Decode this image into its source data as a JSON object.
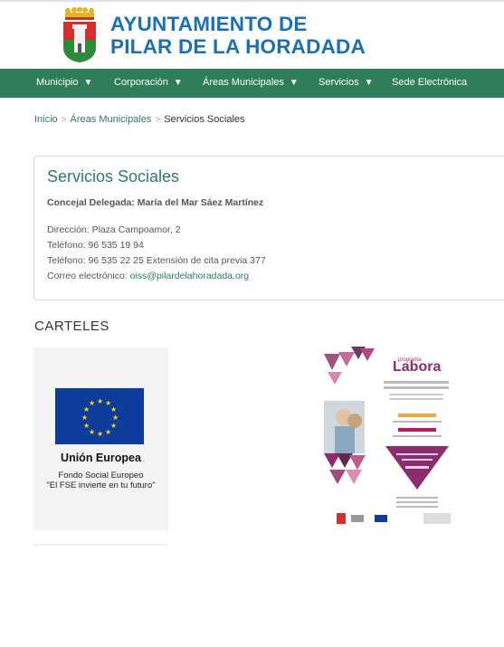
{
  "header": {
    "title_line1": "AYUNTAMIENTO DE",
    "title_line2": "PILAR DE LA HORADADA",
    "crest_icon": "municipal-crest-icon"
  },
  "nav": {
    "items": [
      {
        "label": "Municipio",
        "has_dropdown": true
      },
      {
        "label": "Corporación",
        "has_dropdown": true
      },
      {
        "label": "Áreas Municipales",
        "has_dropdown": true
      },
      {
        "label": "Servicios",
        "has_dropdown": true
      },
      {
        "label": "Sede Electrónica",
        "has_dropdown": false
      }
    ],
    "dropdown_glyph": "▼"
  },
  "breadcrumb": {
    "home": "Inicio",
    "parent": "Áreas Municipales",
    "current": "Servicios Sociales",
    "separator": ">"
  },
  "card": {
    "title": "Servicios Sociales",
    "councillor": "Concejal Delegada: María del Mar Sáez Martínez",
    "address": "Dirección: Plaza Campoamor, 2",
    "phone1": "Teléfono: 96 535 19 94",
    "phone2": "Teléfono: 96 535 22 25 Extensión de cita previa 377",
    "email_label": "Correo electrónico: ",
    "email": "oiss@pilardelahoradada.org"
  },
  "posters": {
    "section_title": "CARTELES",
    "eu": {
      "name": "Unión Europea",
      "fund_line1": "Fondo Social Europeo",
      "fund_line2": "\"El FSE invierte en tu futuro\""
    },
    "labora": {
      "programa": "programa",
      "logo_text": "Labora"
    }
  },
  "colors": {
    "brand_blue": "#1a6fb5",
    "nav_green": "#2e7d5b",
    "eu_blue": "#0d3d9c",
    "eu_star": "#ffd200",
    "labora_magenta": "#8e2a6e"
  }
}
